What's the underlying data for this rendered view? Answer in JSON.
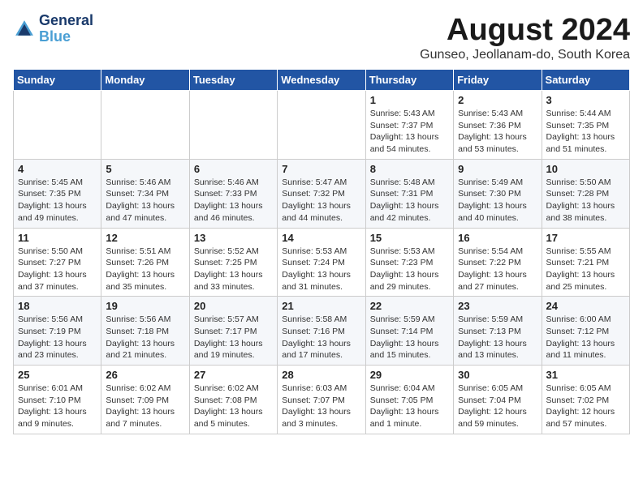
{
  "header": {
    "logo_line1": "General",
    "logo_line2": "Blue",
    "month_title": "August 2024",
    "location": "Gunseo, Jeollanam-do, South Korea"
  },
  "days_of_week": [
    "Sunday",
    "Monday",
    "Tuesday",
    "Wednesday",
    "Thursday",
    "Friday",
    "Saturday"
  ],
  "weeks": [
    [
      {
        "num": "",
        "info": ""
      },
      {
        "num": "",
        "info": ""
      },
      {
        "num": "",
        "info": ""
      },
      {
        "num": "",
        "info": ""
      },
      {
        "num": "1",
        "info": "Sunrise: 5:43 AM\nSunset: 7:37 PM\nDaylight: 13 hours\nand 54 minutes."
      },
      {
        "num": "2",
        "info": "Sunrise: 5:43 AM\nSunset: 7:36 PM\nDaylight: 13 hours\nand 53 minutes."
      },
      {
        "num": "3",
        "info": "Sunrise: 5:44 AM\nSunset: 7:35 PM\nDaylight: 13 hours\nand 51 minutes."
      }
    ],
    [
      {
        "num": "4",
        "info": "Sunrise: 5:45 AM\nSunset: 7:35 PM\nDaylight: 13 hours\nand 49 minutes."
      },
      {
        "num": "5",
        "info": "Sunrise: 5:46 AM\nSunset: 7:34 PM\nDaylight: 13 hours\nand 47 minutes."
      },
      {
        "num": "6",
        "info": "Sunrise: 5:46 AM\nSunset: 7:33 PM\nDaylight: 13 hours\nand 46 minutes."
      },
      {
        "num": "7",
        "info": "Sunrise: 5:47 AM\nSunset: 7:32 PM\nDaylight: 13 hours\nand 44 minutes."
      },
      {
        "num": "8",
        "info": "Sunrise: 5:48 AM\nSunset: 7:31 PM\nDaylight: 13 hours\nand 42 minutes."
      },
      {
        "num": "9",
        "info": "Sunrise: 5:49 AM\nSunset: 7:30 PM\nDaylight: 13 hours\nand 40 minutes."
      },
      {
        "num": "10",
        "info": "Sunrise: 5:50 AM\nSunset: 7:28 PM\nDaylight: 13 hours\nand 38 minutes."
      }
    ],
    [
      {
        "num": "11",
        "info": "Sunrise: 5:50 AM\nSunset: 7:27 PM\nDaylight: 13 hours\nand 37 minutes."
      },
      {
        "num": "12",
        "info": "Sunrise: 5:51 AM\nSunset: 7:26 PM\nDaylight: 13 hours\nand 35 minutes."
      },
      {
        "num": "13",
        "info": "Sunrise: 5:52 AM\nSunset: 7:25 PM\nDaylight: 13 hours\nand 33 minutes."
      },
      {
        "num": "14",
        "info": "Sunrise: 5:53 AM\nSunset: 7:24 PM\nDaylight: 13 hours\nand 31 minutes."
      },
      {
        "num": "15",
        "info": "Sunrise: 5:53 AM\nSunset: 7:23 PM\nDaylight: 13 hours\nand 29 minutes."
      },
      {
        "num": "16",
        "info": "Sunrise: 5:54 AM\nSunset: 7:22 PM\nDaylight: 13 hours\nand 27 minutes."
      },
      {
        "num": "17",
        "info": "Sunrise: 5:55 AM\nSunset: 7:21 PM\nDaylight: 13 hours\nand 25 minutes."
      }
    ],
    [
      {
        "num": "18",
        "info": "Sunrise: 5:56 AM\nSunset: 7:19 PM\nDaylight: 13 hours\nand 23 minutes."
      },
      {
        "num": "19",
        "info": "Sunrise: 5:56 AM\nSunset: 7:18 PM\nDaylight: 13 hours\nand 21 minutes."
      },
      {
        "num": "20",
        "info": "Sunrise: 5:57 AM\nSunset: 7:17 PM\nDaylight: 13 hours\nand 19 minutes."
      },
      {
        "num": "21",
        "info": "Sunrise: 5:58 AM\nSunset: 7:16 PM\nDaylight: 13 hours\nand 17 minutes."
      },
      {
        "num": "22",
        "info": "Sunrise: 5:59 AM\nSunset: 7:14 PM\nDaylight: 13 hours\nand 15 minutes."
      },
      {
        "num": "23",
        "info": "Sunrise: 5:59 AM\nSunset: 7:13 PM\nDaylight: 13 hours\nand 13 minutes."
      },
      {
        "num": "24",
        "info": "Sunrise: 6:00 AM\nSunset: 7:12 PM\nDaylight: 13 hours\nand 11 minutes."
      }
    ],
    [
      {
        "num": "25",
        "info": "Sunrise: 6:01 AM\nSunset: 7:10 PM\nDaylight: 13 hours\nand 9 minutes."
      },
      {
        "num": "26",
        "info": "Sunrise: 6:02 AM\nSunset: 7:09 PM\nDaylight: 13 hours\nand 7 minutes."
      },
      {
        "num": "27",
        "info": "Sunrise: 6:02 AM\nSunset: 7:08 PM\nDaylight: 13 hours\nand 5 minutes."
      },
      {
        "num": "28",
        "info": "Sunrise: 6:03 AM\nSunset: 7:07 PM\nDaylight: 13 hours\nand 3 minutes."
      },
      {
        "num": "29",
        "info": "Sunrise: 6:04 AM\nSunset: 7:05 PM\nDaylight: 13 hours\nand 1 minute."
      },
      {
        "num": "30",
        "info": "Sunrise: 6:05 AM\nSunset: 7:04 PM\nDaylight: 12 hours\nand 59 minutes."
      },
      {
        "num": "31",
        "info": "Sunrise: 6:05 AM\nSunset: 7:02 PM\nDaylight: 12 hours\nand 57 minutes."
      }
    ]
  ]
}
